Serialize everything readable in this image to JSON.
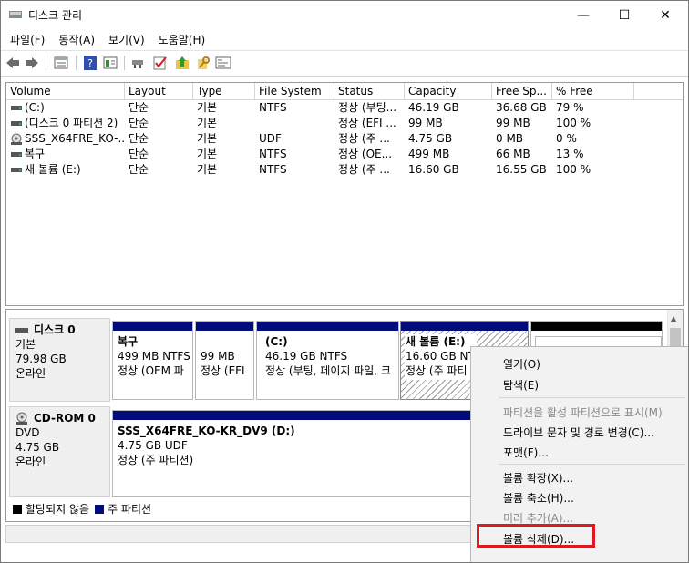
{
  "window": {
    "title": "디스크 관리",
    "minimize": "—",
    "maximize": "☐",
    "close": "✕"
  },
  "menubar": [
    "파일(F)",
    "동작(A)",
    "보기(V)",
    "도움말(H)"
  ],
  "toolbar": {
    "icons": [
      "back-arrow-icon",
      "forward-arrow-icon",
      "properties-icon",
      "help-icon",
      "view-icon",
      "connect-icon",
      "check-icon",
      "folder-up-icon",
      "key-icon",
      "console-icon"
    ]
  },
  "volume_list": {
    "columns": [
      "Volume",
      "Layout",
      "Type",
      "File System",
      "Status",
      "Capacity",
      "Free Sp...",
      "% Free"
    ],
    "rows": [
      {
        "volume": "(C:)",
        "layout": "단순",
        "type": "기본",
        "fs": "NTFS",
        "status": "정상 (부팅...",
        "capacity": "46.19 GB",
        "free": "36.68 GB",
        "pct": "79 %",
        "icon": "drive-icon"
      },
      {
        "volume": "(디스크 0 파티션 2)",
        "layout": "단순",
        "type": "기본",
        "fs": "",
        "status": "정상 (EFI ...",
        "capacity": "99 MB",
        "free": "99 MB",
        "pct": "100 %",
        "icon": "drive-icon"
      },
      {
        "volume": "SSS_X64FRE_KO-...",
        "layout": "단순",
        "type": "기본",
        "fs": "UDF",
        "status": "정상 (주 ...",
        "capacity": "4.75 GB",
        "free": "0 MB",
        "pct": "0 %",
        "icon": "cd-icon"
      },
      {
        "volume": "복구",
        "layout": "단순",
        "type": "기본",
        "fs": "NTFS",
        "status": "정상 (OE...",
        "capacity": "499 MB",
        "free": "66 MB",
        "pct": "13 %",
        "icon": "drive-icon"
      },
      {
        "volume": "새 볼륨 (E:)",
        "layout": "단순",
        "type": "기본",
        "fs": "NTFS",
        "status": "정상 (주 ...",
        "capacity": "16.60 GB",
        "free": "16.55 GB",
        "pct": "100 %",
        "icon": "drive-icon"
      }
    ]
  },
  "disks": [
    {
      "name": "디스크 0",
      "type": "기본",
      "size": "79.98 GB",
      "state": "온라인",
      "partitions": [
        {
          "line1": "복구",
          "line2": "499 MB NTFS",
          "line3": "정상 (OEM 파"
        },
        {
          "line1": "",
          "line2": "99 MB",
          "line3": "정상 (EFI"
        },
        {
          "line1": "(C:)",
          "line2": "46.19 GB NTFS",
          "line3": "정상 (부팅, 페이지 파일, 크"
        },
        {
          "line1": "새 볼륨  (E:)",
          "line2": "16.60 GB NT",
          "line3": "정상 (주 파티"
        },
        {
          "line1": "",
          "line2": "",
          "line3": ""
        }
      ]
    },
    {
      "name": "CD-ROM 0",
      "type": "DVD",
      "size": "4.75 GB",
      "state": "온라인",
      "partitions": [
        {
          "line1": "SSS_X64FRE_KO-KR_DV9  (D:)",
          "line2": "4.75 GB UDF",
          "line3": "정상 (주 파티션)"
        }
      ]
    }
  ],
  "legend": {
    "unallocated": "할당되지 않음",
    "primary": "주 파티션"
  },
  "colors": {
    "primary": "#000c7b",
    "unallocated": "#000000",
    "highlight": "#e0191e"
  },
  "context_menu": {
    "items": [
      {
        "label": "열기(O)",
        "enabled": true
      },
      {
        "label": "탐색(E)",
        "enabled": true
      },
      {
        "label": "파티션을 활성 파티션으로 표시(M)",
        "enabled": false
      },
      {
        "label": "드라이브 문자 및 경로 변경(C)...",
        "enabled": true
      },
      {
        "label": "포맷(F)...",
        "enabled": true
      },
      {
        "label": "볼륨 확장(X)...",
        "enabled": true
      },
      {
        "label": "볼륨 축소(H)...",
        "enabled": true
      },
      {
        "label": "미러 추가(A)...",
        "enabled": false
      },
      {
        "label": "볼륨 삭제(D)...",
        "enabled": true
      }
    ]
  }
}
